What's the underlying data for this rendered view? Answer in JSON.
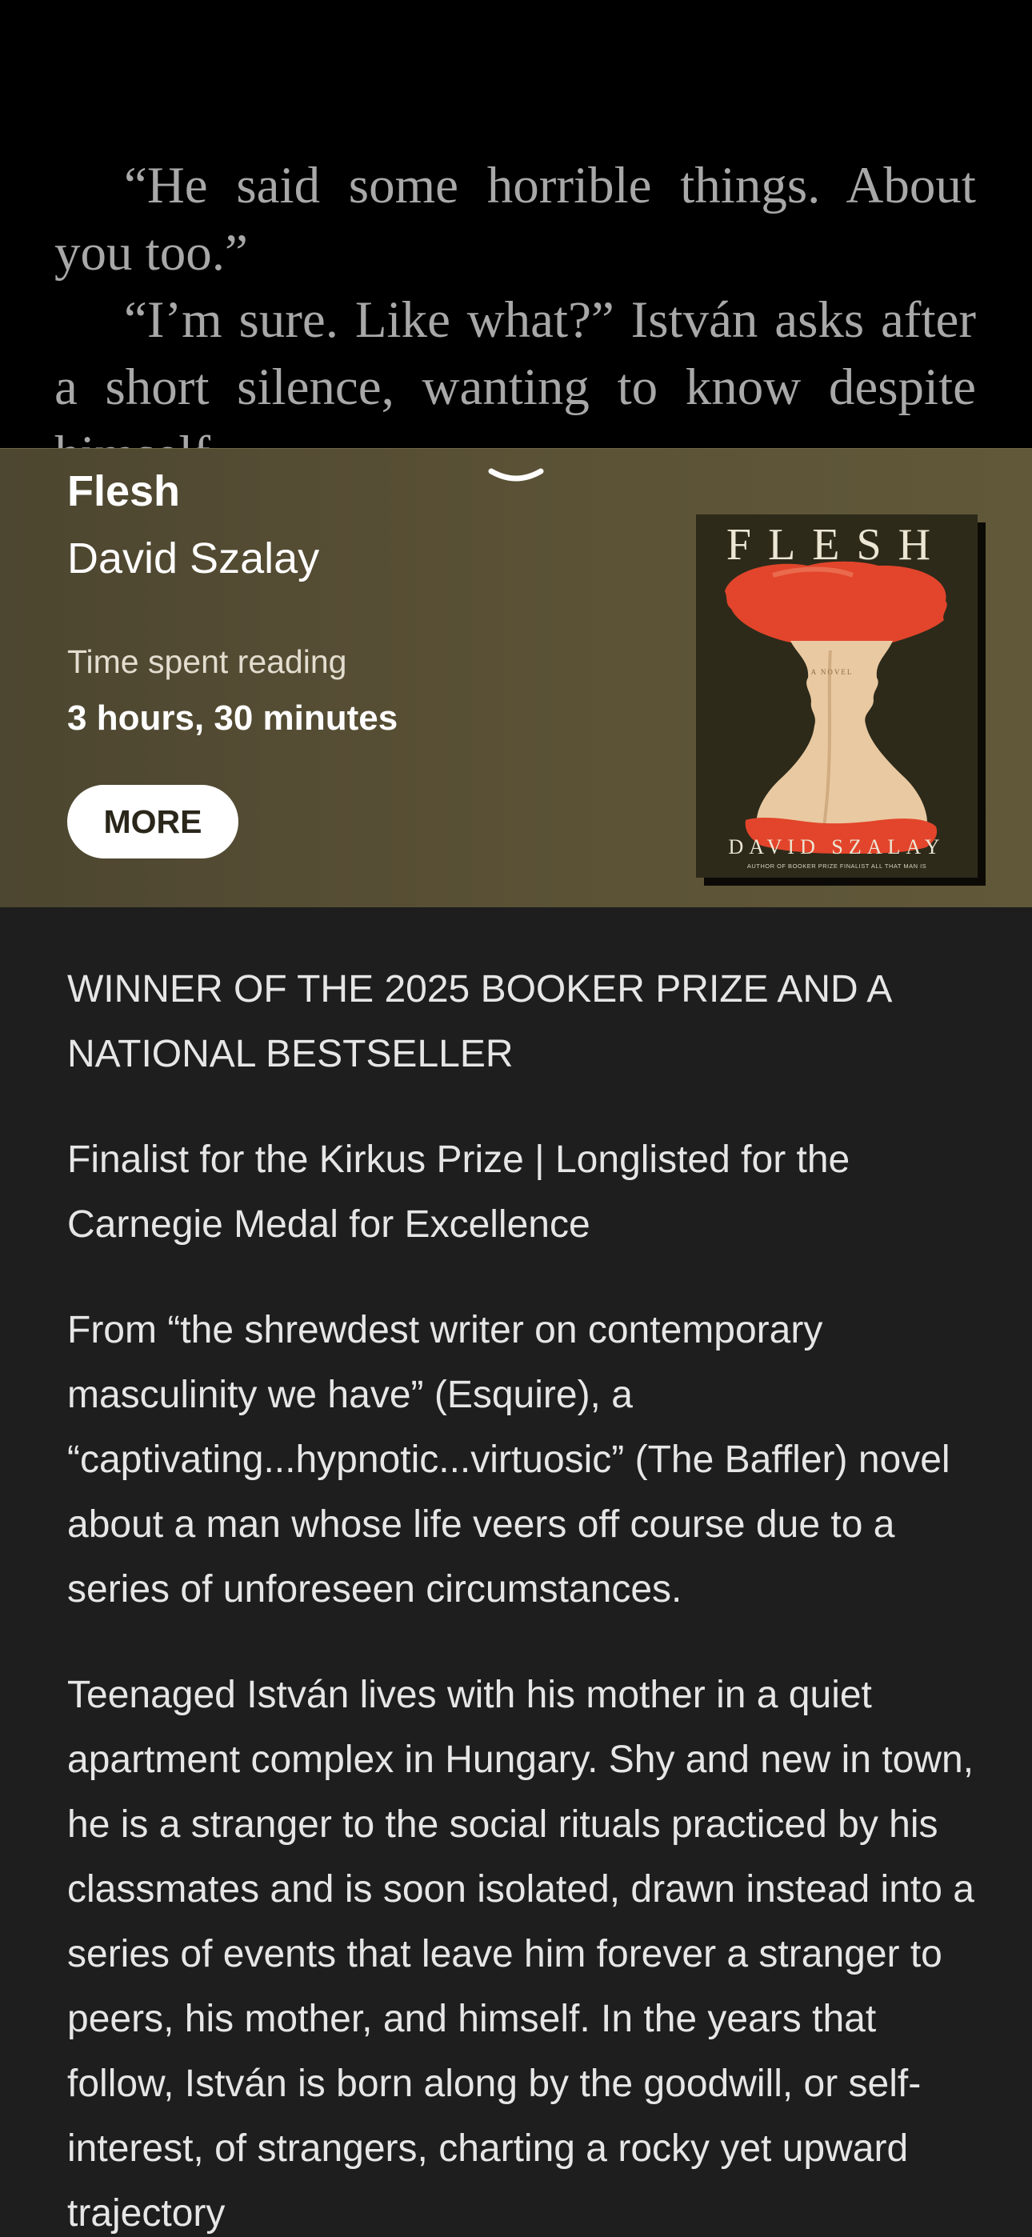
{
  "reader": {
    "paragraph_1": "“He said some horrible things. About you too.”",
    "paragraph_2": "“I’m sure. Like what?” István asks after a short silence, wanting to know despite himself."
  },
  "panel": {
    "title": "Flesh",
    "author": "David Szalay",
    "time_label": "Time spent reading",
    "time_value": "3 hours, 30 minutes",
    "more_label": "MORE",
    "cover": {
      "title": "FLESH",
      "subtitle": "A NOVEL",
      "author": "DAVID SZALAY",
      "tagline": "AUTHOR OF BOOKER PRIZE FINALIST ALL THAT MAN IS"
    }
  },
  "description": {
    "paragraphs": [
      "WINNER OF THE 2025 BOOKER PRIZE AND A NATIONAL BESTSELLER",
      "Finalist for the Kirkus Prize | Longlisted for the Carnegie Medal for Excellence",
      "From “the shrewdest writer on contemporary masculinity we have” (Esquire), a “captivating...hypnotic...virtuosic” (The Baffler) novel about a man whose life veers off course due to a series of unforeseen circumstances.",
      "Teenaged István lives with his mother in a quiet apartment complex in Hungary. Shy and new in town, he is a stranger to the social rituals practiced by his classmates and is soon isolated, drawn instead into a series of events that leave him forever a stranger to peers, his mother, and himself. In the years that follow, István is born along by the goodwill, or self-interest, of strangers, charting a rocky yet upward trajectory"
    ]
  },
  "colors": {
    "reader_background": "#000000",
    "reader_text": "#a8a8a8",
    "panel_background": "#5b5236",
    "description_background": "#1e1e1e",
    "cover_background": "#2d2a1a",
    "apple_red": "#e2452b"
  },
  "icons": {
    "collapse": "chevron-down-icon"
  }
}
